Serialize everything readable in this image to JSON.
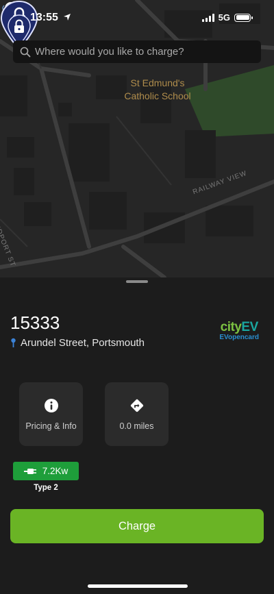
{
  "status_bar": {
    "time": "13:55",
    "network": "5G"
  },
  "search": {
    "placeholder": "Where would you like to charge?"
  },
  "map": {
    "place_label_line1": "St Edmund's",
    "place_label_line2": "Catholic School",
    "street_railway": "RAILWAY VIEW",
    "street_ridport": "RIDPORT ST"
  },
  "station": {
    "id": "15333",
    "address": "Arundel Street, Portsmouth",
    "brand_city": "city",
    "brand_ev": "EV",
    "brand_sub": "EVopencard"
  },
  "tiles": {
    "info_label": "Pricing & Info",
    "distance_label": "0.0 miles"
  },
  "connector": {
    "power": "7.2Kw",
    "type": "Type 2"
  },
  "actions": {
    "charge_label": "Charge"
  },
  "colors": {
    "accent_green": "#6ab425",
    "connector_green": "#1e9e3a",
    "pin_navy": "#1e2a6b"
  }
}
